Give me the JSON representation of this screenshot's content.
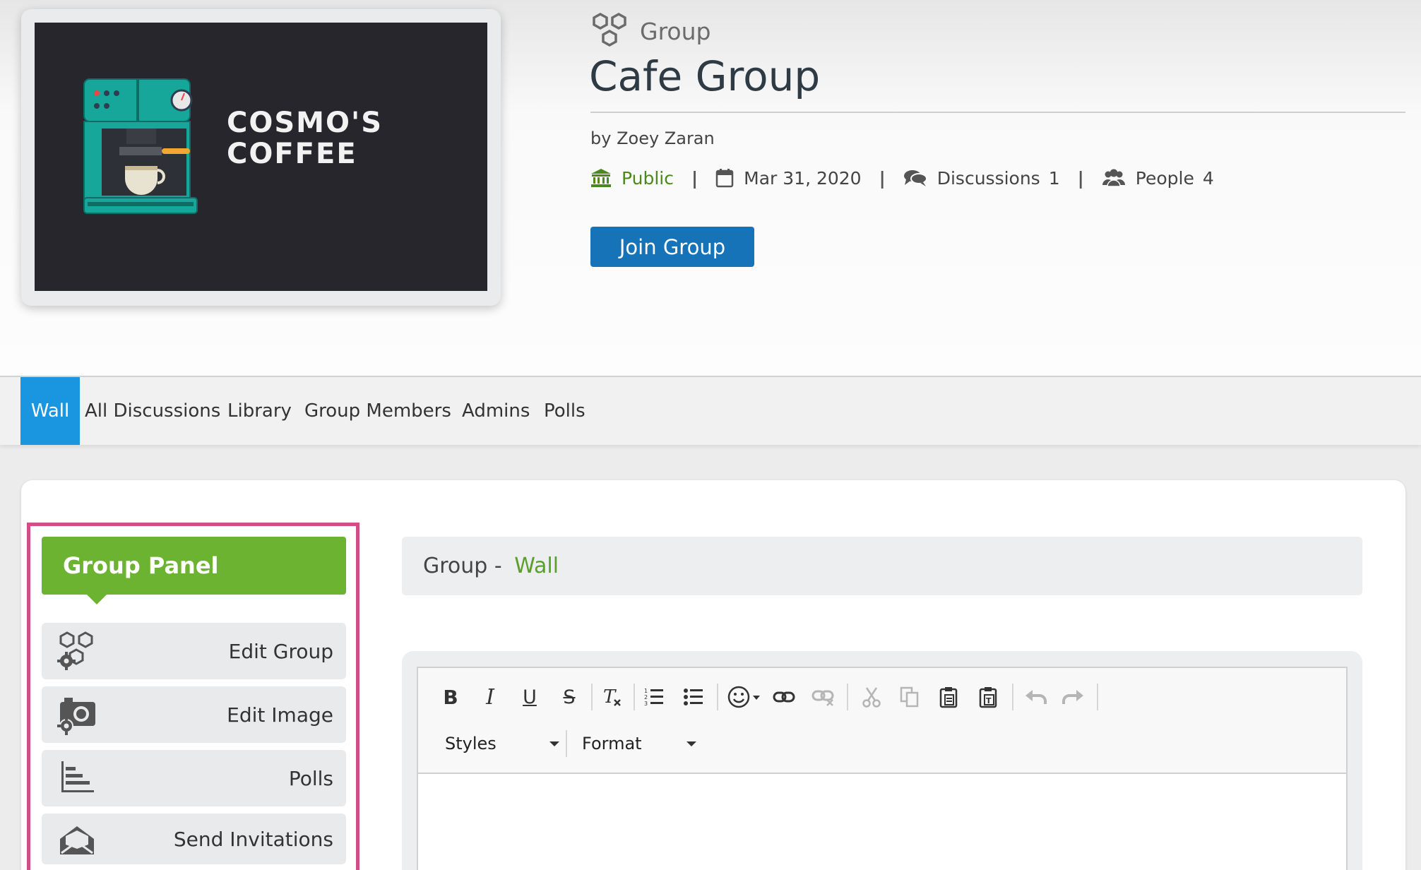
{
  "cover": {
    "brand_line1": "COSMO'S",
    "brand_line2": "COFFEE"
  },
  "group": {
    "kicker": "Group",
    "title": "Cafe Group",
    "author": "by Zoey Zaran",
    "visibility": "Public",
    "date": "Mar 31, 2020",
    "discussions_label": "Discussions",
    "discussions_count": "1",
    "people_label": "People",
    "people_count": "4",
    "separator": "|",
    "join_label": "Join Group"
  },
  "tabs": [
    "Wall",
    "All Discussions",
    "Library",
    "Group Members",
    "Admins",
    "Polls"
  ],
  "panel": {
    "title": "Group Panel",
    "items": [
      "Edit Group",
      "Edit Image",
      "Polls",
      "Send Invitations"
    ]
  },
  "wall": {
    "prefix": "Group - ",
    "section": "Wall"
  },
  "editor": {
    "styles_label": "Styles",
    "format_label": "Format"
  },
  "colors": {
    "primary_button": "#1773b8",
    "active_tab": "#1a96e0",
    "panel_header": "#6db332",
    "highlight_outline": "#d14f86",
    "public_green": "#4a8a1c"
  }
}
